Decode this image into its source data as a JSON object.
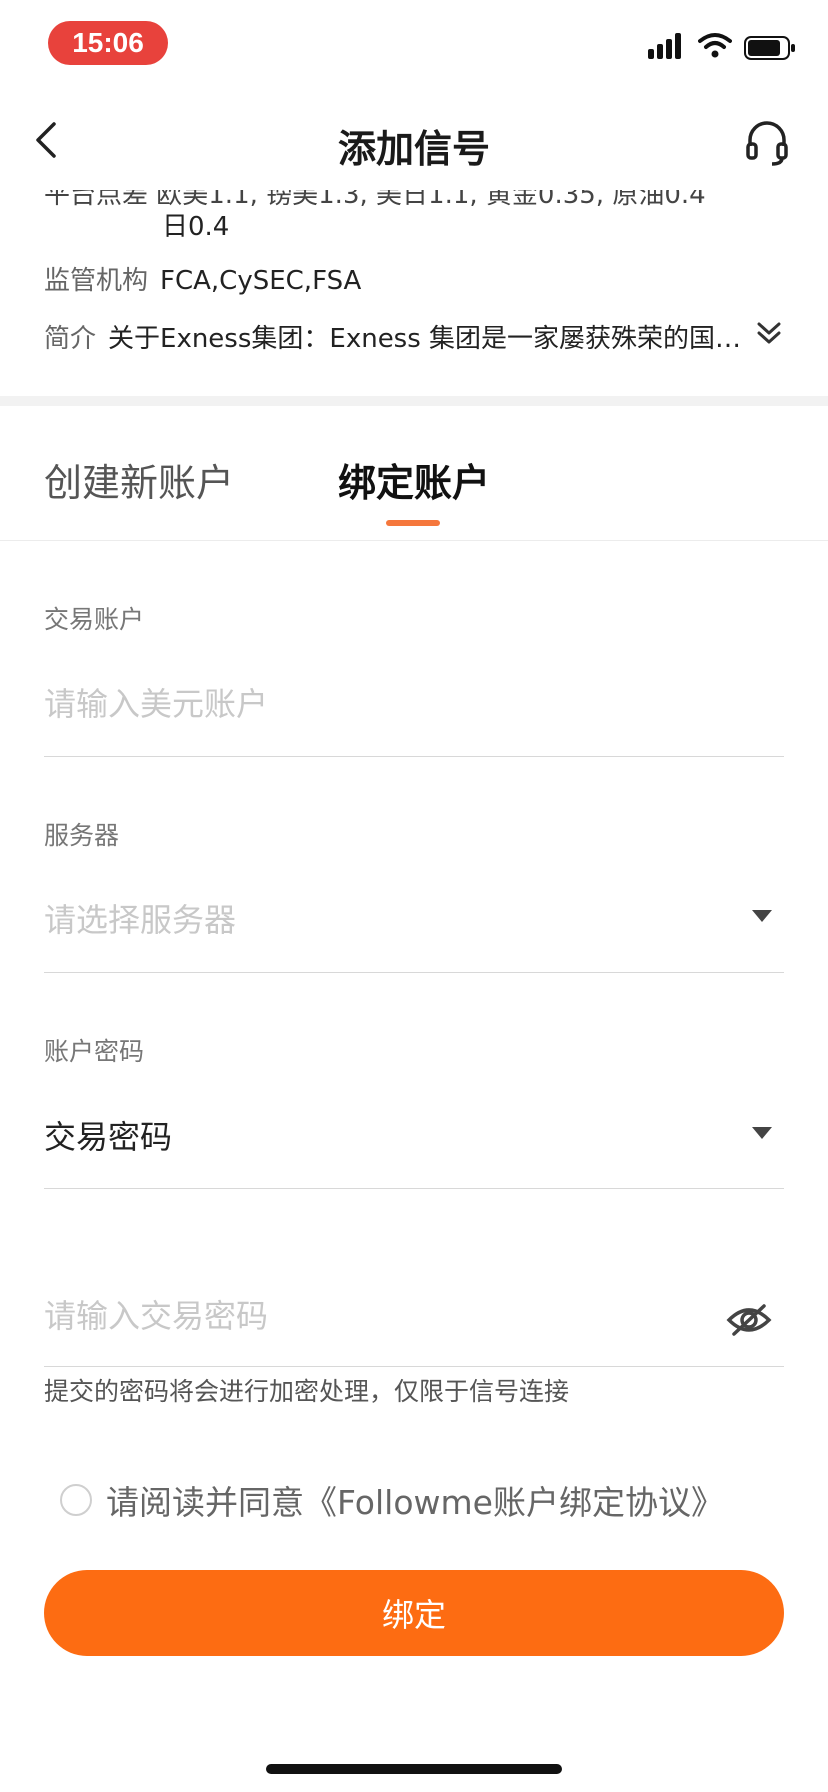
{
  "status_bar": {
    "time": "15:06"
  },
  "nav": {
    "title": "添加信号",
    "back_icon": "chevron-left-icon",
    "support_icon": "headset-icon"
  },
  "broker_info": {
    "cutoff_text": "平台点差 欧美1.1, 镑美1.3, 美日1.1, 黄金0.35, 原油0.4",
    "wrapped_text": "日0.4",
    "regulator_label": "监管机构",
    "regulator_value": "FCA,CySEC,FSA",
    "intro_label": "简介",
    "intro_value": "关于Exness集团：Exness 集团是一家屡获殊荣的国际...",
    "expand_icon": "double-chevron-down-icon"
  },
  "tabs": [
    {
      "label": "创建新账户",
      "active": false
    },
    {
      "label": "绑定账户",
      "active": true
    }
  ],
  "form": {
    "account": {
      "label": "交易账户",
      "placeholder": "请输入美元账户"
    },
    "server": {
      "label": "服务器",
      "placeholder": "请选择服务器"
    },
    "password_type": {
      "label": "账户密码",
      "value": "交易密码"
    },
    "password": {
      "placeholder": "请输入交易密码",
      "hint": "提交的密码将会进行加密处理，仅限于信号连接"
    }
  },
  "agreement": {
    "text": "请阅读并同意",
    "link": "《Followme账户绑定协议》"
  },
  "submit_label": "绑定",
  "colors": {
    "accent": "#fd6c12",
    "tab_indicator": "#f5773c",
    "time_pill": "#e8423c"
  }
}
